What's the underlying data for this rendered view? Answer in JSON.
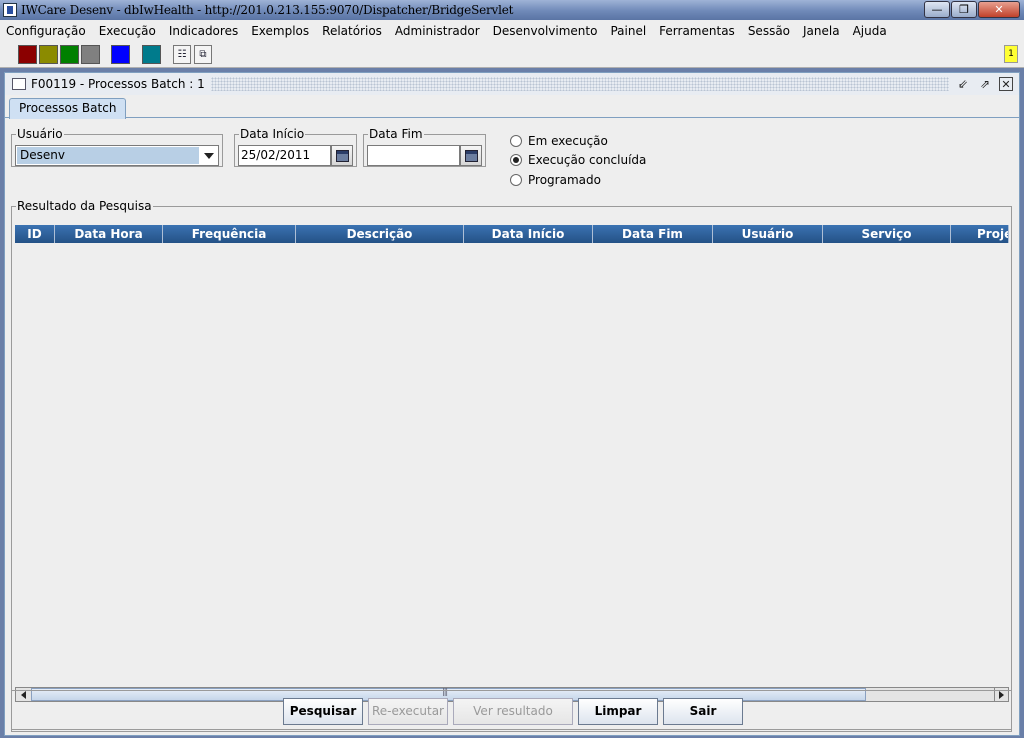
{
  "window": {
    "title": "IWCare Desenv - dbIwHealth - http://201.0.213.155:9070/Dispatcher/BridgeServlet"
  },
  "menu": [
    "Configuração",
    "Execução",
    "Indicadores",
    "Exemplos",
    "Relatórios",
    "Administrador",
    "Desenvolvimento",
    "Painel",
    "Ferramentas",
    "Sessão",
    "Janela",
    "Ajuda"
  ],
  "toolbar": {
    "swatches": [
      "#8b0000",
      "#8b8b00",
      "#008000",
      "#808080",
      "#0000ff",
      "#007b8c"
    ],
    "notification_count": "1"
  },
  "frame": {
    "title": "F00119 - Processos Batch : 1"
  },
  "tab": {
    "label": "Processos Batch"
  },
  "filters": {
    "usuario_label": "Usuário",
    "usuario_value": "Desenv",
    "data_inicio_label": "Data Início",
    "data_inicio_value": "25/02/2011",
    "data_fim_label": "Data Fim",
    "data_fim_value": ""
  },
  "status_options": [
    {
      "label": "Em execução",
      "checked": false
    },
    {
      "label": "Execução concluída",
      "checked": true
    },
    {
      "label": "Programado",
      "checked": false
    }
  ],
  "results": {
    "legend": "Resultado da Pesquisa",
    "columns": [
      "ID",
      "Data Hora",
      "Frequência",
      "Descrição",
      "Data Início",
      "Data Fim",
      "Usuário",
      "Serviço",
      "Proje"
    ]
  },
  "buttons": {
    "pesquisar": "Pesquisar",
    "reexecutar": "Re-executar",
    "ver_resultado": "Ver resultado",
    "limpar": "Limpar",
    "sair": "Sair"
  }
}
